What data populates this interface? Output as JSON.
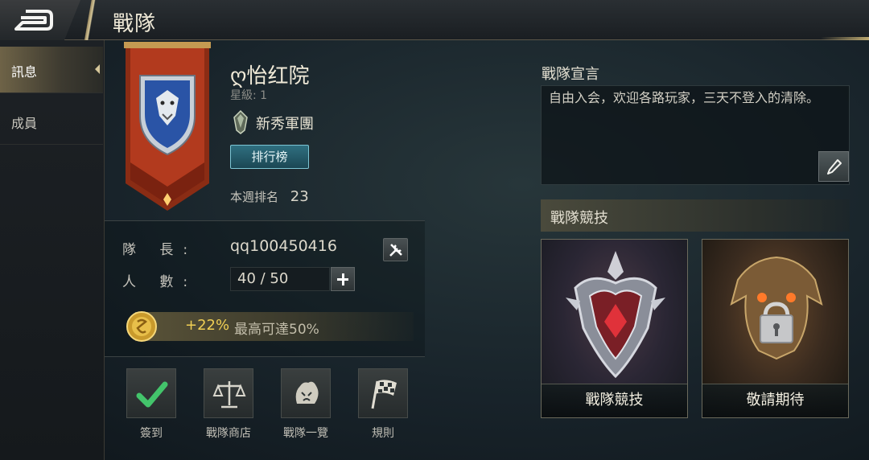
{
  "header": {
    "title": "戰隊"
  },
  "sidebar": {
    "items": [
      {
        "label": "訊息",
        "active": true
      },
      {
        "label": "成員",
        "active": false
      }
    ]
  },
  "team": {
    "name": "ღ怡红院",
    "star_level": "星級: 1",
    "rank_name": "新秀軍團",
    "leaderboard_button": "排行榜",
    "weekly_rank_label": "本週排名",
    "weekly_rank_value": "23"
  },
  "members": {
    "captain_label": "隊 長:",
    "captain_name": "qq100450416",
    "count_label": "人 數:",
    "count_value": "40 / 50"
  },
  "bonus": {
    "percent": "+22%",
    "text": "最高可達50%"
  },
  "actions": [
    {
      "label": "簽到",
      "icon": "checkmark-icon"
    },
    {
      "label": "戰隊商店",
      "icon": "scales-icon"
    },
    {
      "label": "戰隊一覽",
      "icon": "beast-icon"
    },
    {
      "label": "規則",
      "icon": "checkered-flag-icon"
    }
  ],
  "declaration": {
    "title": "戰隊宣言",
    "text": "自由入会，欢迎各路玩家，三天不登入的清除。"
  },
  "competition": {
    "title": "戰隊競技",
    "cards": [
      {
        "label": "戰隊競技"
      },
      {
        "label": "敬請期待"
      }
    ]
  },
  "colors": {
    "accent_gold": "#d6c79a",
    "bonus_yellow": "#f0cf54",
    "button_teal": "#2f6f80",
    "banner_red": "#b23a1e"
  }
}
